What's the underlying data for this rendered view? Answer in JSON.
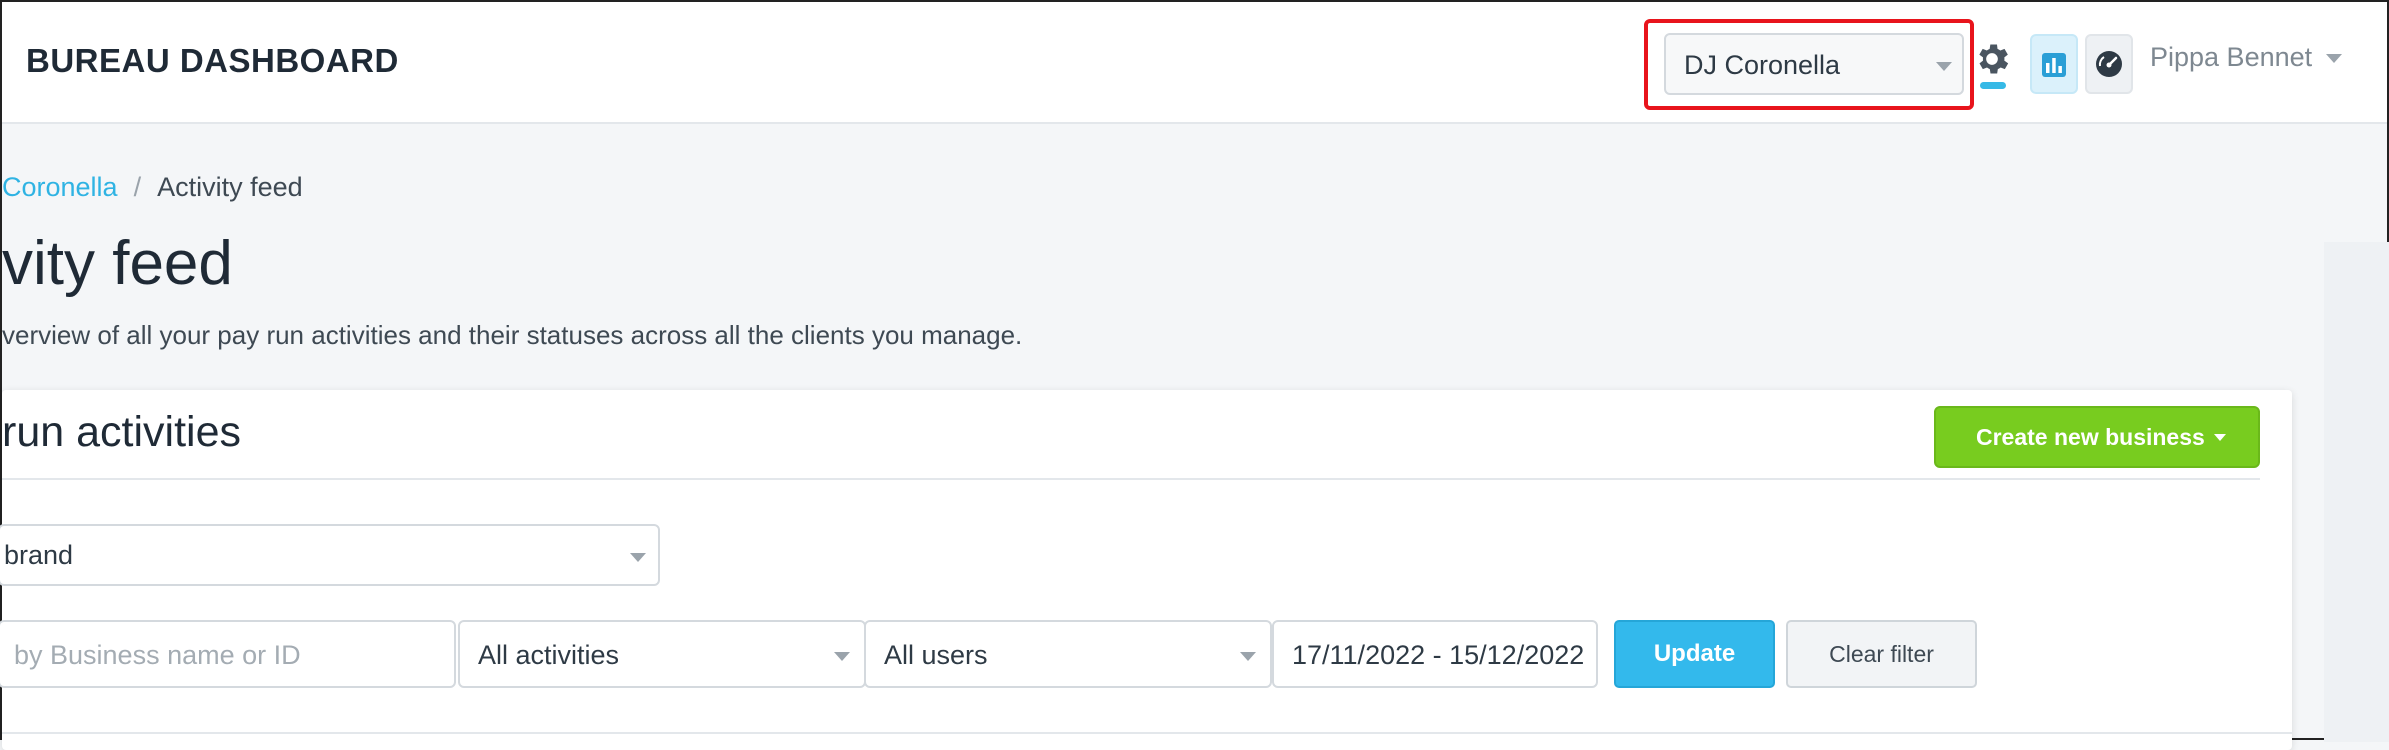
{
  "header": {
    "brand": "BUREAU DASHBOARD",
    "business_select": "DJ Coronella",
    "user_name": "Pippa Bennet",
    "icons": [
      "gear-icon",
      "bar-chart-icon",
      "speedometer-icon",
      "chevron-down-icon"
    ],
    "accent_color": "#36b9e6",
    "highlight_color": "#e8141c"
  },
  "breadcrumb": {
    "parent": "Coronella",
    "separator": "/",
    "current": "Activity feed"
  },
  "page": {
    "title": "vity feed",
    "subtitle": "verview of all your pay run activities and their statuses across all the clients you manage."
  },
  "card": {
    "title": "run activities",
    "create_button": "Create new business",
    "create_button_color": "#78cc1f",
    "brand_select": "brand",
    "search_placeholder": "by Business name or ID",
    "activity_select": "All activities",
    "user_select": "All users",
    "date_range": "17/11/2022 - 15/12/2022",
    "update_button": "Update",
    "update_button_color": "#33b9ec",
    "clear_button": "Clear filter"
  }
}
